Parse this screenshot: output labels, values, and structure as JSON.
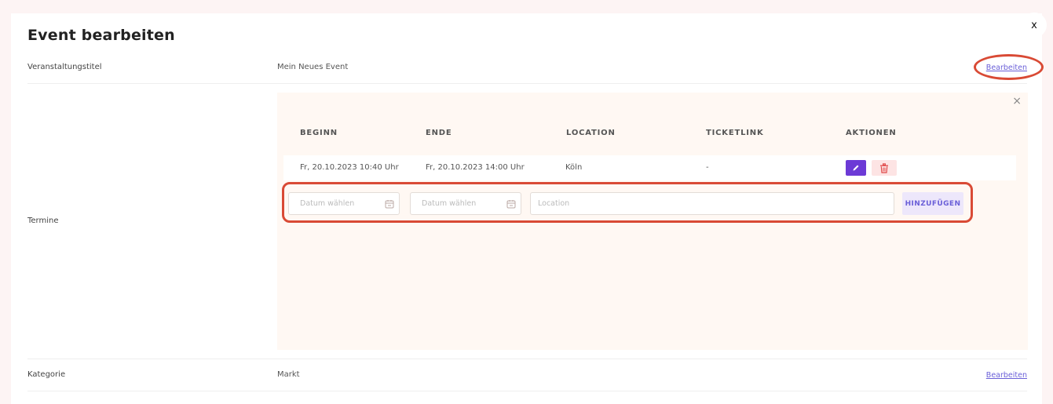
{
  "window": {
    "close_label": "x",
    "title": "Event bearbeiten"
  },
  "rows": {
    "title_row": {
      "label": "Veranstaltungstitel",
      "value": "Mein Neues Event",
      "edit": "Bearbeiten"
    },
    "termine_row": {
      "label": "Termine"
    },
    "kategorie_row": {
      "label": "Kategorie",
      "value": "Markt",
      "edit": "Bearbeiten"
    }
  },
  "termine": {
    "close_label": "×",
    "headers": [
      "BEGINN",
      "ENDE",
      "LOCATION",
      "TICKETLINK",
      "AKTIONEN"
    ],
    "entries": [
      {
        "beginn": "Fr, 20.10.2023 10:40 Uhr",
        "ende": "Fr, 20.10.2023 14:00 Uhr",
        "location": "Köln",
        "ticketlink": "-"
      }
    ],
    "form": {
      "begin_placeholder": "Datum wählen",
      "end_placeholder": "Datum wählen",
      "location_placeholder": "Location",
      "add_label": "HINZUFÜGEN"
    }
  },
  "colors": {
    "accent": "#6c3ad6",
    "highlight": "#d94a35",
    "link": "#6a5fd8",
    "panel": "#fff8f3"
  },
  "icons": [
    "close-icon",
    "pencil-icon",
    "trash-icon",
    "calendar-icon"
  ]
}
